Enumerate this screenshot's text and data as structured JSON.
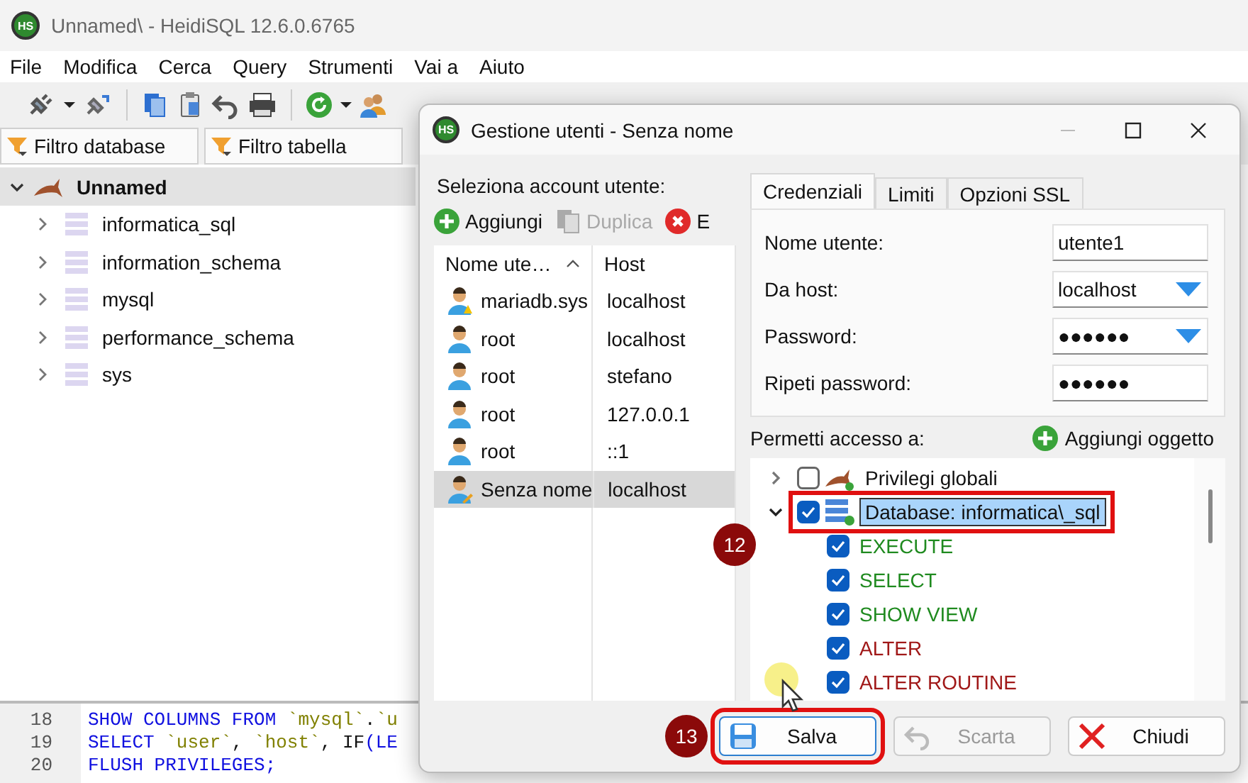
{
  "window": {
    "logo_text": "HS",
    "title": "Unnamed\\ - HeidiSQL 12.6.0.6765"
  },
  "menu": [
    "File",
    "Modifica",
    "Cerca",
    "Query",
    "Strumenti",
    "Vai a",
    "Aiuto"
  ],
  "filters": [
    {
      "label": "Filtro database"
    },
    {
      "label": "Filtro tabella"
    }
  ],
  "db_tree": {
    "label": "Unnamed",
    "expanded": true,
    "children": [
      {
        "label": "informatica_sql",
        "expanded": false
      },
      {
        "label": "information_schema",
        "expanded": false
      },
      {
        "label": "mysql",
        "expanded": false
      },
      {
        "label": "performance_schema",
        "expanded": false
      },
      {
        "label": "sys",
        "expanded": false
      }
    ]
  },
  "editor": {
    "lines": [
      {
        "number": "18",
        "tokens": [
          {
            "text": "SHOW COLUMNS FROM ",
            "kind": "keyword"
          },
          {
            "text": "`mysql`",
            "kind": "identifier"
          },
          {
            "text": ".",
            "kind": "plain"
          },
          {
            "text": "`u",
            "kind": "identifier"
          }
        ]
      },
      {
        "number": "19",
        "tokens": [
          {
            "text": "SELECT ",
            "kind": "keyword"
          },
          {
            "text": "`user`",
            "kind": "identifier"
          },
          {
            "text": ", ",
            "kind": "plain"
          },
          {
            "text": "`host`",
            "kind": "identifier"
          },
          {
            "text": ", ",
            "kind": "plain"
          },
          {
            "text": "IF",
            "kind": "plain"
          },
          {
            "text": "(LE",
            "kind": "keyword"
          }
        ]
      },
      {
        "number": "20",
        "tokens": [
          {
            "text": "FLUSH PRIVILEGES;",
            "kind": "keyword"
          }
        ]
      }
    ]
  },
  "dialog": {
    "logo_text": "HS",
    "title": "Gestione utenti - Senza nome",
    "accounts": {
      "label": "Seleziona account utente:",
      "actions": [
        {
          "label": "Aggiungi",
          "kind": "add",
          "disabled": false
        },
        {
          "label": "Duplica",
          "kind": "duplicate",
          "disabled": true
        },
        {
          "label": "E",
          "kind": "delete",
          "disabled": false
        }
      ],
      "columns": [
        {
          "label": "Nome ute…",
          "sorted": true
        },
        {
          "label": "Host",
          "sorted": false
        }
      ],
      "rows": [
        {
          "name": "mariadb.sys",
          "host": "localhost",
          "kind": "warning",
          "selected": false
        },
        {
          "name": "root",
          "host": "localhost",
          "kind": "plain",
          "selected": false
        },
        {
          "name": "root",
          "host": "stefano",
          "kind": "plain",
          "selected": false
        },
        {
          "name": "root",
          "host": "127.0.0.1",
          "kind": "plain",
          "selected": false
        },
        {
          "name": "root",
          "host": "::1",
          "kind": "plain",
          "selected": false
        },
        {
          "name": "Senza nome",
          "host": "localhost",
          "kind": "edit",
          "selected": true
        }
      ]
    },
    "tabs": [
      {
        "label": "Credenziali",
        "selected": true
      },
      {
        "label": "Limiti",
        "selected": false
      },
      {
        "label": "Opzioni SSL",
        "selected": false
      }
    ],
    "fields": [
      {
        "label": "Nome utente:",
        "value": "utente1",
        "kind": "text"
      },
      {
        "label": "Da host:",
        "value": "localhost",
        "kind": "combo"
      },
      {
        "label": "Password:",
        "value": "●●●●●●",
        "kind": "combo"
      },
      {
        "label": "Ripeti password:",
        "value": "●●●●●●",
        "kind": "text"
      }
    ],
    "access": {
      "label": "Permetti accesso a:",
      "add_label": "Aggiungi oggetto",
      "items": [
        {
          "label": "Privilegi globali",
          "kind": "global",
          "expanded": false,
          "checked": false,
          "selected": false,
          "highlighted": false
        },
        {
          "label": "Database: informatica\\_sql",
          "kind": "database",
          "expanded": true,
          "checked": true,
          "selected": true,
          "highlighted": true,
          "callout": "12",
          "children": [
            {
              "label": "EXECUTE",
              "checked": true,
              "color": "#1f8a1f"
            },
            {
              "label": "SELECT",
              "checked": true,
              "color": "#1f8a1f"
            },
            {
              "label": "SHOW VIEW",
              "checked": true,
              "color": "#1f8a1f"
            },
            {
              "label": "ALTER",
              "checked": true,
              "color": "#a01818"
            },
            {
              "label": "ALTER ROUTINE",
              "checked": true,
              "color": "#a01818"
            }
          ]
        }
      ]
    },
    "buttons": [
      {
        "label": "Salva",
        "kind": "save",
        "disabled": false,
        "highlighted": true,
        "callout": "13"
      },
      {
        "label": "Scarta",
        "kind": "discard",
        "disabled": true,
        "highlighted": false
      },
      {
        "label": "Chiudi",
        "kind": "close",
        "disabled": false,
        "highlighted": false
      }
    ]
  }
}
